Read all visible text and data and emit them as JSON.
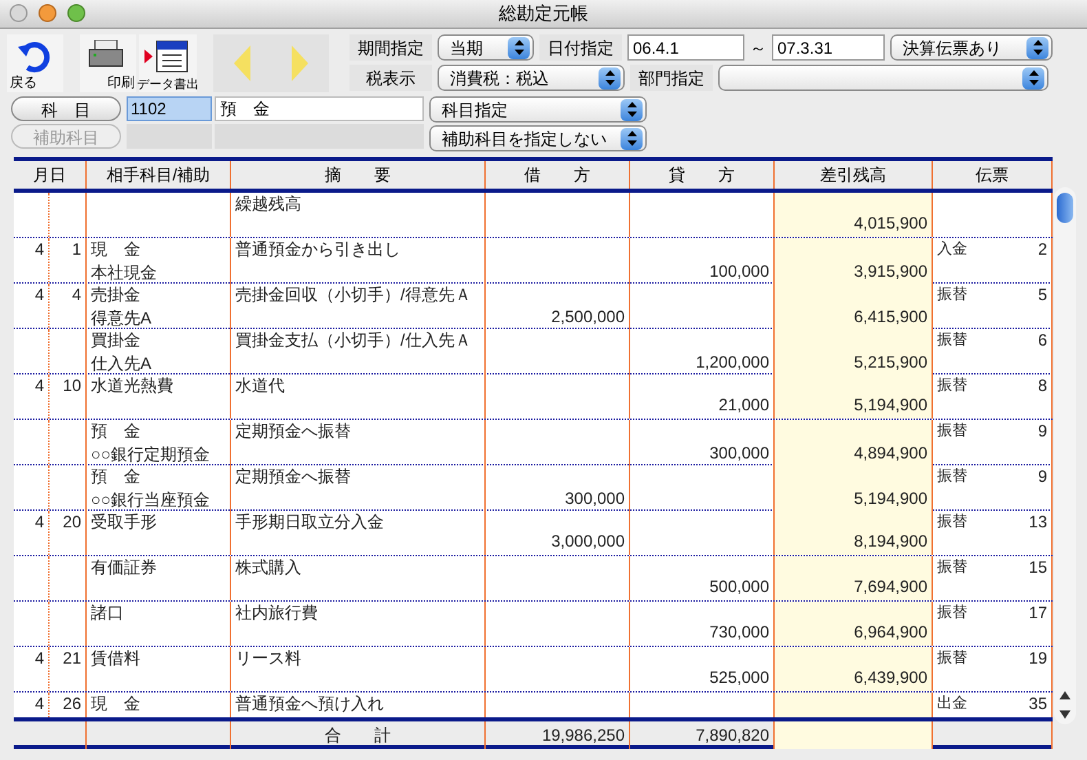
{
  "window": {
    "title": "総勘定元帳"
  },
  "toolbar": {
    "back": "戻る",
    "print": "印刷",
    "export": "データ書出",
    "prev_disabled": true,
    "next_disabled": true
  },
  "filters": {
    "period_label": "期間指定",
    "period": "当期",
    "date_label": "日付指定",
    "date_from": "06.4.1",
    "date_sep": "～",
    "date_to": "07.3.31",
    "closing": "決算伝票あり",
    "tax_label": "税表示",
    "tax": "消費税：税込",
    "dept_label": "部門指定"
  },
  "account": {
    "button": "科　目",
    "code": "1102",
    "code_selected": true,
    "name": "預　金",
    "mode": "科目指定",
    "sub_button": "補助科目",
    "sub_disabled": true,
    "sub_mode": "補助科目を指定しない"
  },
  "table": {
    "columns": [
      "月日",
      "相手科目/補助",
      "摘　　要",
      "借　　方",
      "貸　　方",
      "差引残高",
      "伝票"
    ],
    "rows": [
      {
        "month": "",
        "day": "",
        "account": "",
        "sub": "",
        "desc": "繰越残高",
        "debit": "",
        "credit": "",
        "balance": "4,015,900",
        "slip": "",
        "no": ""
      },
      {
        "month": "4",
        "day": "1",
        "account": "現　金",
        "sub": "本社現金",
        "desc": "普通預金から引き出し",
        "debit": "",
        "credit": "100,000",
        "balance": "3,915,900",
        "slip": "入金",
        "no": "2"
      },
      {
        "month": "4",
        "day": "4",
        "account": "売掛金",
        "sub": "得意先A",
        "desc": "売掛金回収（小切手）/得意先Ａ",
        "debit": "2,500,000",
        "credit": "",
        "balance": "6,415,900",
        "slip": "振替",
        "no": "5"
      },
      {
        "month": "",
        "day": "",
        "account": "買掛金",
        "sub": "仕入先A",
        "desc": "買掛金支払（小切手）/仕入先Ａ",
        "debit": "",
        "credit": "1,200,000",
        "balance": "5,215,900",
        "slip": "振替",
        "no": "6"
      },
      {
        "month": "4",
        "day": "10",
        "account": "水道光熱費",
        "sub": "",
        "desc": "水道代",
        "debit": "",
        "credit": "21,000",
        "balance": "5,194,900",
        "slip": "振替",
        "no": "8"
      },
      {
        "month": "",
        "day": "",
        "account": "預　金",
        "sub": "○○銀行定期預金",
        "desc": "定期預金へ振替",
        "debit": "",
        "credit": "300,000",
        "balance": "4,894,900",
        "slip": "振替",
        "no": "9"
      },
      {
        "month": "",
        "day": "",
        "account": "預　金",
        "sub": "○○銀行当座預金",
        "desc": "定期預金へ振替",
        "debit": "300,000",
        "credit": "",
        "balance": "5,194,900",
        "slip": "振替",
        "no": "9"
      },
      {
        "month": "4",
        "day": "20",
        "account": "受取手形",
        "sub": "",
        "desc": "手形期日取立分入金",
        "debit": "3,000,000",
        "credit": "",
        "balance": "8,194,900",
        "slip": "振替",
        "no": "13"
      },
      {
        "month": "",
        "day": "",
        "account": "有価証券",
        "sub": "",
        "desc": "株式購入",
        "debit": "",
        "credit": "500,000",
        "balance": "7,694,900",
        "slip": "振替",
        "no": "15"
      },
      {
        "month": "",
        "day": "",
        "account": "諸口",
        "sub": "",
        "desc": "社内旅行費",
        "debit": "",
        "credit": "730,000",
        "balance": "6,964,900",
        "slip": "振替",
        "no": "17"
      },
      {
        "month": "4",
        "day": "21",
        "account": "賃借料",
        "sub": "",
        "desc": "リース料",
        "debit": "",
        "credit": "525,000",
        "balance": "6,439,900",
        "slip": "振替",
        "no": "19"
      },
      {
        "month": "4",
        "day": "26",
        "account": "現　金",
        "sub": "",
        "desc": "普通預金へ預け入れ",
        "debit": "",
        "credit": "",
        "balance": "",
        "slip": "出金",
        "no": "35"
      }
    ],
    "total": {
      "label": "合　　計",
      "debit": "19,986,250",
      "credit": "7,890,820"
    }
  }
}
